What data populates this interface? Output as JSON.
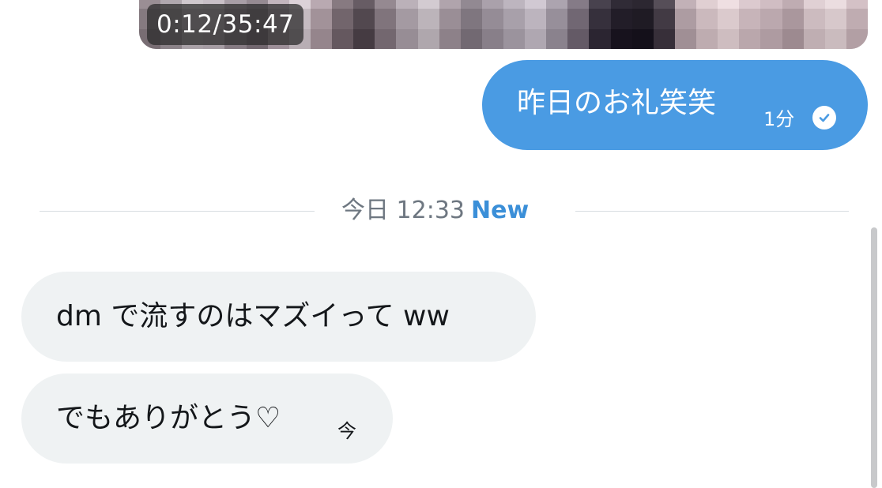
{
  "video": {
    "timestamp": "0:12/35:47",
    "pixel_colors": [
      "#8f8389",
      "#a29aa0",
      "#c3bcc2",
      "#bfb6bd",
      "#9e939c",
      "#8a7f87",
      "#b7a9b2",
      "#d2c8ce",
      "#ae9ea6",
      "#7e7178",
      "#5c5259",
      "#8c8088",
      "#b0a6ae",
      "#c8c0c6",
      "#a69aa2",
      "#898089",
      "#9f96a0",
      "#b2aab4",
      "#c6bec8",
      "#a199a4",
      "#7a707c",
      "#3e3844",
      "#2a2530",
      "#26222b",
      "#4b434d",
      "#b8a7ad",
      "#d6c4c8",
      "#e6d5d8",
      "#d2bfc4",
      "#c6b3b9",
      "#b5a2a8",
      "#d7c6ca",
      "#e2d3d6",
      "#cab7bc",
      "#9a8e94",
      "#b0a8ae",
      "#cfc8cd",
      "#c9c0c7",
      "#a89ea6",
      "#958a92",
      "#c2b5bd",
      "#dcd2d8",
      "#b9a9b1",
      "#877a81",
      "#675c64",
      "#958991",
      "#bbb1b9",
      "#d3cbd1",
      "#b0a4ac",
      "#928992",
      "#aaa1ab",
      "#bdb5bf",
      "#d1c9d3",
      "#aca4af",
      "#857b87",
      "#48424e",
      "#302b36",
      "#2c2731",
      "#564e58",
      "#c2b1b7",
      "#e0cfd2",
      "#efdfe2",
      "#dccacf",
      "#d0bdc3",
      "#bfacb2",
      "#e0d0d4",
      "#ebdde0",
      "#d4c1c6",
      "#857a80",
      "#988f95",
      "#b6aeb4",
      "#b2a9b0",
      "#92878f",
      "#7f747c",
      "#aa9ca5",
      "#c5bbc1",
      "#a29299",
      "#72656c",
      "#52484f",
      "#80747c",
      "#a49aa2",
      "#bcb4ba",
      "#9a8e96",
      "#7f767f",
      "#958c96",
      "#a8a0aa",
      "#bcb4be",
      "#978f9a",
      "#716773",
      "#36303c",
      "#221d28",
      "#1f1b24",
      "#423a44",
      "#ad9ca2",
      "#cbb9bd",
      "#dbcacd",
      "#c7b4b9",
      "#bba8ae",
      "#aa979d",
      "#ccbbbf",
      "#d7c8cb",
      "#bfacb1",
      "#786d73",
      "#8b8288",
      "#a9a1a7",
      "#a59ca3",
      "#857a82",
      "#72676f",
      "#9d8f98",
      "#b8aeb4",
      "#95858c",
      "#65585f",
      "#453b42",
      "#73676f",
      "#978d95",
      "#afa7ad",
      "#8d8189",
      "#726972",
      "#887f89",
      "#9b939d",
      "#afa7b1",
      "#8a828d",
      "#645a66",
      "#2b2531",
      "#17121d",
      "#14101a",
      "#372f39",
      "#a08f95",
      "#beacb0",
      "#cebdc0",
      "#baa7ac",
      "#ae9ba1",
      "#9d8a90",
      "#bfaeb2",
      "#cabbbe",
      "#b29fa4"
    ]
  },
  "outgoing_message": {
    "text": "昨日のお礼笑笑",
    "time": "1分",
    "colors": {
      "bubble": "#4a9be3",
      "text": "#ffffff"
    },
    "status_icon": "read-checkmark-icon"
  },
  "separator": {
    "date_label": "今日 12:33",
    "new_label": "New",
    "new_color": "#3b8fd8"
  },
  "incoming_messages": [
    {
      "text": "dm で流すのはマズイって ww",
      "time": ""
    },
    {
      "text": "でもありがとう♡",
      "time": "今"
    }
  ]
}
